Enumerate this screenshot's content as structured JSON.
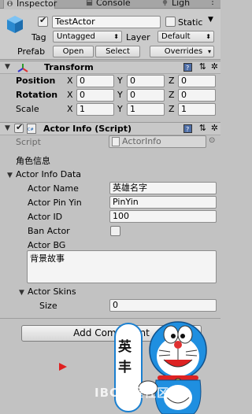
{
  "tabs": {
    "inspector": "Inspector",
    "console": "Console",
    "lighting": "Ligh"
  },
  "object": {
    "name": "TestActor",
    "static_label": "Static",
    "tag_label": "Tag",
    "tag_value": "Untagged",
    "layer_label": "Layer",
    "layer_value": "Default",
    "prefab_label": "Prefab",
    "open_label": "Open",
    "select_label": "Select",
    "overrides_label": "Overrides"
  },
  "transform": {
    "title": "Transform",
    "position_label": "Position",
    "rotation_label": "Rotation",
    "scale_label": "Scale",
    "x": "X",
    "y": "Y",
    "z": "Z",
    "position": [
      "0",
      "0",
      "0"
    ],
    "rotation": [
      "0",
      "0",
      "0"
    ],
    "scale": [
      "1",
      "1",
      "1"
    ]
  },
  "actor_info": {
    "title": "Actor Info (Script)",
    "script_label": "Script",
    "script_value": "ActorInfo",
    "header_text": "角色信息",
    "data_label": "Actor Info Data",
    "name_label": "Actor Name",
    "name_value": "英雄名字",
    "pinyin_label": "Actor Pin Yin",
    "pinyin_value": "PinYin",
    "id_label": "Actor ID",
    "id_value": "100",
    "ban_label": "Ban Actor",
    "bg_label": "Actor BG",
    "bg_value": "背景故事",
    "skins_label": "Actor Skins",
    "size_label": "Size",
    "size_value": "0"
  },
  "add_component_label": "Add Component",
  "overlay": {
    "sign_text": "英丰",
    "watermark": "IBC编程社区"
  },
  "colors": {
    "panel_bg": "#c2c2c2",
    "header_bg": "#c8c8c8",
    "transform_icon_red": "#d33",
    "transform_icon_green": "#3a3",
    "transform_icon_blue": "#33c",
    "doraemon_blue": "#1f8fe0"
  }
}
